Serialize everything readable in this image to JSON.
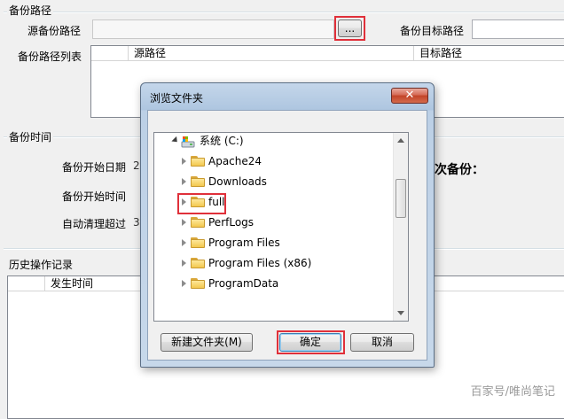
{
  "source_section": {
    "title": "备份路径",
    "source_label": "源备份路径",
    "browse_button": "...",
    "target_label": "备份目标路径",
    "list_label": "备份路径列表",
    "columns": [
      "源路径",
      "目标路径"
    ]
  },
  "time_section": {
    "title": "备份时间",
    "start_date_label": "备份开始日期",
    "start_date_value": "2",
    "start_time_label": "备份开始时间",
    "auto_clean_label": "自动清理超过",
    "auto_clean_value": "3",
    "next_backup_label": "次备份："
  },
  "history_section": {
    "title": "历史操作记录",
    "columns": [
      "发生时间"
    ]
  },
  "dialog": {
    "title": "浏览文件夹",
    "close_glyph": "✕",
    "tree_root": "系统 (C:)",
    "folders": [
      "Apache24",
      "Downloads",
      "full",
      "PerfLogs",
      "Program Files",
      "Program Files (x86)",
      "ProgramData"
    ],
    "new_folder_button": "新建文件夹(M)",
    "ok_button": "确定",
    "cancel_button": "取消"
  },
  "watermark": "百家号/唯尚笔记",
  "accent_colors": {
    "highlight_box": "#e0303a",
    "dialog_frame": "#aec6e0"
  },
  "icons": [
    "computer-drive-icon",
    "folder-icon",
    "expand-arrow-icon",
    "close-icon"
  ]
}
